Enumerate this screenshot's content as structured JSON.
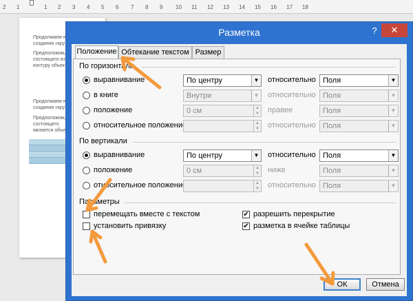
{
  "ruler": {
    "ticks": [
      "2",
      "1",
      "1",
      "2",
      "3",
      "4",
      "5",
      "6",
      "7",
      "8",
      "9",
      "10",
      "11",
      "12",
      "13",
      "14",
      "15",
      "16",
      "17",
      "18"
    ]
  },
  "document": {
    "lines": [
      "Продолжаем н\nсоздания «кру",
      "Предположим,\nсостоящего из\nконтуру объект",
      "Продолжаем н\nсоздания «кру",
      "Предположим,\nсостоящего\nявляется объек"
    ]
  },
  "dialog": {
    "title": "Разметка",
    "help": "?",
    "close": "✕",
    "tabs": [
      "Положение",
      "Обтекание текстом",
      "Размер"
    ],
    "horizontal": {
      "title": "По горизонтали",
      "rows": [
        {
          "label": "выравнивание",
          "value": "По центру",
          "rel_label": "относительно",
          "rel_value": "Поля"
        },
        {
          "label": "в книге",
          "value": "Внутри",
          "rel_label": "относительно",
          "rel_value": "Поля"
        },
        {
          "label": "положение",
          "value": "0 см",
          "rel_label": "правее",
          "rel_value": "Поля"
        },
        {
          "label": "относительное положение",
          "value": "",
          "rel_label": "относительно",
          "rel_value": "Поля"
        }
      ]
    },
    "vertical": {
      "title": "По вертикали",
      "rows": [
        {
          "label": "выравнивание",
          "value": "По центру",
          "rel_label": "относительно",
          "rel_value": "Поля"
        },
        {
          "label": "положение",
          "value": "0 см",
          "rel_label": "ниже",
          "rel_value": "Поля"
        },
        {
          "label": "относительное положение",
          "value": "",
          "rel_label": "относительно",
          "rel_value": "Поля"
        }
      ]
    },
    "options": {
      "title": "Параметры",
      "move_with_text": "перемещать вместе с текстом",
      "lock_anchor": "установить привязку",
      "allow_overlap": "разрешить перекрытие",
      "layout_in_cell": "разметка в ячейке таблицы"
    },
    "buttons": {
      "ok": "ОК",
      "cancel": "Отмена"
    }
  },
  "colors": {
    "title_bar": "#2f73d0",
    "close_button": "#c7463a",
    "annotation_arrows": "#f39a3c",
    "table_fill": "#bcd9e8"
  }
}
